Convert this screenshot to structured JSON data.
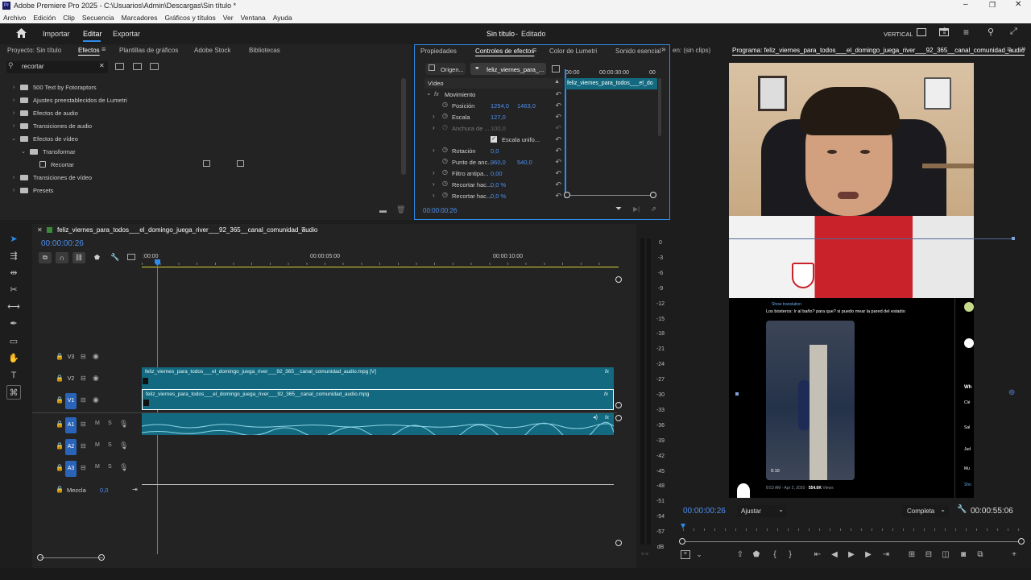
{
  "app": {
    "title": "Adobe Premiere Pro 2025 - C:\\Usuarios\\Admin\\Descargas\\Sin título *",
    "menu": [
      "Archivo",
      "Edición",
      "Clip",
      "Secuencia",
      "Marcadores",
      "Gráficos y títulos",
      "Ver",
      "Ventana",
      "Ayuda"
    ]
  },
  "header": {
    "nav": [
      "Importar",
      "Editar",
      "Exportar"
    ],
    "active_nav": "Editar",
    "project_title": "Sin título",
    "status": "Editado",
    "layout_label": "VERTICAL"
  },
  "effects_panel": {
    "tabs": [
      "Proyecto: Sin título",
      "Efectos",
      "Plantillas de gráficos",
      "Adobe Stock",
      "Bibliotecas"
    ],
    "search_value": "recortar",
    "tree": [
      {
        "label": "500 Text by Fotoraptors",
        "level": 0,
        "expanded": false
      },
      {
        "label": "Ajustes preestablecidos de Lumetri",
        "level": 0,
        "expanded": false
      },
      {
        "label": "Efectos de audio",
        "level": 0,
        "expanded": false
      },
      {
        "label": "Transiciones de audio",
        "level": 0,
        "expanded": false
      },
      {
        "label": "Efectos de vídeo",
        "level": 0,
        "expanded": true
      },
      {
        "label": "Transformar",
        "level": 1,
        "expanded": true
      },
      {
        "label": "Recortar",
        "level": 2,
        "expanded": false
      },
      {
        "label": "Transiciones de vídeo",
        "level": 0,
        "expanded": false
      },
      {
        "label": "Presets",
        "level": 0,
        "expanded": false
      }
    ]
  },
  "effect_controls": {
    "tabs": [
      "Propiedades",
      "Controles de efectos",
      "Color de Lumetri",
      "Sonido esencial"
    ],
    "source_tab": "Origen...",
    "clip_tab": "feliz_viernes_para_...",
    "timecodes": [
      "00:00",
      "00:00:30:00",
      "00"
    ],
    "clip_label": "feliz_viernes_para_todos___el_do",
    "section": "Vídeo",
    "motion": "Movimiento",
    "rows": [
      {
        "label": "Posición",
        "v1": "1254,0",
        "v2": "1463,0"
      },
      {
        "label": "Escala",
        "v1": "127,0",
        "v2": ""
      },
      {
        "label": "Anchura de ...",
        "v1": "100,0",
        "v2": ""
      },
      {
        "label": "Escala unifo...",
        "v1": "",
        "v2": ""
      },
      {
        "label": "Rotación",
        "v1": "0,0",
        "v2": ""
      },
      {
        "label": "Punto de anc...",
        "v1": "960,0",
        "v2": "540,0"
      },
      {
        "label": "Filtro antipa...",
        "v1": "0,00",
        "v2": ""
      },
      {
        "label": "Recortar hac...",
        "v1": "0,0 %",
        "v2": ""
      },
      {
        "label": "Recortar hac...",
        "v1": "0,0 %",
        "v2": ""
      }
    ],
    "timecode": "00:00:00:26"
  },
  "program_monitor": {
    "source_tab": "en: (sin clips)",
    "title": "Programa: feliz_viernes_para_todos___el_domingo_juega_river___92_365__canal_comunidad_audio",
    "current_time": "00:00:00:26",
    "fit": "Ajustar",
    "quality": "Completa",
    "duration": "00:00:55:06",
    "tweet": {
      "translation": "Show translation",
      "text": "Los bosteros: Ir al baño? para que? si puedo mear la pared del estadio",
      "video_time": "0:10",
      "meta": "8:53 AM - Apr 2, 2020 · ",
      "views": "554.6K",
      "views_word": " Views",
      "side_labels": [
        "Wh",
        "Clé",
        "Sal",
        "Jud",
        "Mu",
        "Sho"
      ]
    }
  },
  "timeline": {
    "sequence_name": "feliz_viernes_para_todos___el_domingo_juega_river___92_365__canal_comunidad_audio",
    "timecode": "00:00:00:26",
    "ruler": [
      ":00:00",
      "00:00:05:00",
      "00:00:10:00"
    ],
    "tracks": [
      {
        "id": "V3",
        "type": "video"
      },
      {
        "id": "V2",
        "type": "video"
      },
      {
        "id": "V1",
        "type": "video"
      },
      {
        "id": "A1",
        "type": "audio"
      },
      {
        "id": "A2",
        "type": "audio"
      },
      {
        "id": "A3",
        "type": "audio"
      }
    ],
    "mix_label": "Mezcla",
    "mix_value": "0,0",
    "clip_v2": "feliz_viernes_para_todos___el_domingo_juega_river___92_365__canal_comunidad_audio.mpg [V]",
    "clip_v1": "feliz_viernes_para_todos___el_domingo_juega_river___92_365__canal_comunidad_audio.mpg",
    "fx": "fx"
  },
  "meter_scale": [
    "0",
    "-3",
    "-6",
    "-9",
    "-12",
    "-15",
    "-18",
    "-21",
    "-24",
    "-27",
    "-30",
    "-33",
    "-36",
    "-39",
    "-42",
    "-45",
    "-48",
    "-51",
    "-54",
    "-57",
    "dB"
  ],
  "colors": {
    "accent": "#2d8ceb",
    "clip": "#136a80",
    "track_badge": "#2a64b8",
    "playhead": "#2d8ceb"
  }
}
